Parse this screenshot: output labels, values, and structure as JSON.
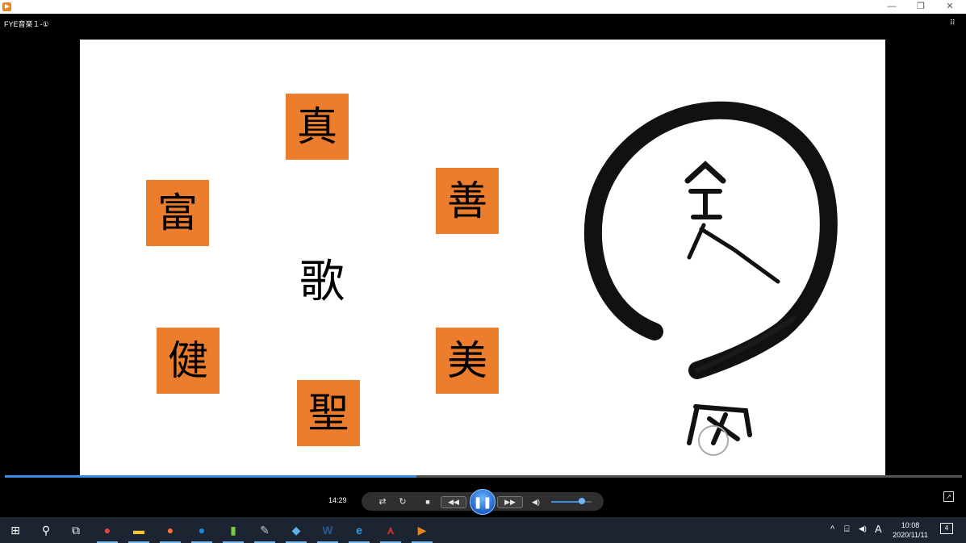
{
  "window": {
    "subtitle": "FYE音楽１-①",
    "minimize_label": "—",
    "restore_label": "❐",
    "close_label": "✕",
    "layout_icon": "grid-icon"
  },
  "slide": {
    "cards": [
      {
        "char": "真"
      },
      {
        "char": "富"
      },
      {
        "char": "善"
      },
      {
        "char": "健"
      },
      {
        "char": "美"
      },
      {
        "char": "聖"
      }
    ],
    "center_char": "歌",
    "card_color": "#ec7d2d"
  },
  "player": {
    "progress": 0.43,
    "time": "14:29",
    "shuffle_label": "⇄",
    "repeat_label": "↻",
    "stop_label": "■",
    "prev_label": "◀◀",
    "play_pause_label": "❚❚",
    "next_label": "▶▶",
    "volume_icon_label": "◀)",
    "volume": 0.75,
    "fullscreen_label": "↗",
    "accent": "#3a8ee6"
  },
  "taskbar": {
    "start_label": "⊞",
    "search_label": "⚲",
    "taskview_label": "⧉",
    "apps": [
      {
        "name": "chrome-icon",
        "glyph": "●",
        "color": "#e8453c"
      },
      {
        "name": "file-explorer-icon",
        "glyph": "▬",
        "color": "#f4c531"
      },
      {
        "name": "firefox-icon",
        "glyph": "●",
        "color": "#ff7139"
      },
      {
        "name": "mail-icon",
        "glyph": "●",
        "color": "#1a8ae5"
      },
      {
        "name": "green-app-icon",
        "glyph": "▮",
        "color": "#7ac943"
      },
      {
        "name": "paint-icon",
        "glyph": "✎",
        "color": "#c8c8c8"
      },
      {
        "name": "app-icon-blue",
        "glyph": "◆",
        "color": "#5fb2e8"
      },
      {
        "name": "word-icon",
        "glyph": "W",
        "color": "#2b5797"
      },
      {
        "name": "ie-icon",
        "glyph": "e",
        "color": "#2a9df4"
      },
      {
        "name": "acrobat-icon",
        "glyph": "⋏",
        "color": "#d32f2f"
      },
      {
        "name": "media-player-icon",
        "glyph": "▶",
        "color": "#e8861c"
      }
    ],
    "tray_chevron": "^",
    "tray_network": "⌸",
    "tray_volume": "◀)",
    "ime_label": "A",
    "clock_time": "10:08",
    "clock_date": "2020/11/11",
    "notifications": "4"
  }
}
